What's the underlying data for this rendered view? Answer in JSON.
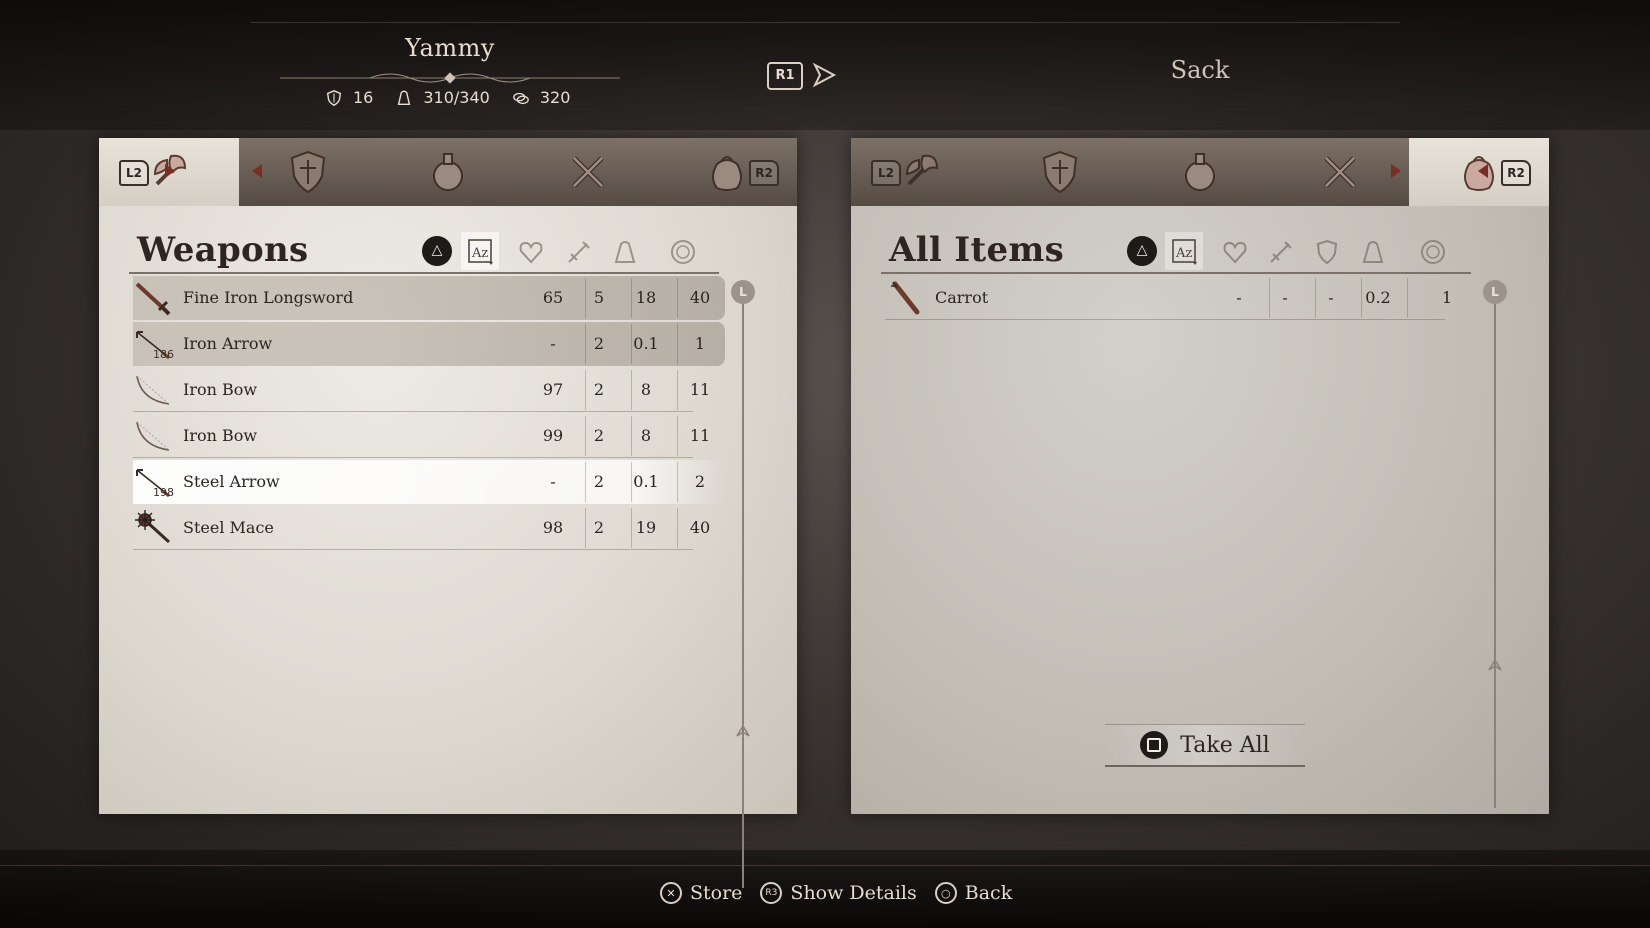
{
  "header": {
    "character_name": "Yammy",
    "defense": "16",
    "weight": "310/340",
    "money": "320",
    "r1_label": "R1",
    "container_title": "Sack"
  },
  "left_panel": {
    "bumper_left": "L2",
    "bumper_right": "R2",
    "tabs": [
      {
        "icon": "axe-icon",
        "active": true
      },
      {
        "icon": "armor-shield-icon",
        "active": false
      },
      {
        "icon": "potion-icon",
        "active": false
      },
      {
        "icon": "tools-icon",
        "active": false
      },
      {
        "icon": "food-sack-icon",
        "active": false
      }
    ],
    "title": "Weapons",
    "sort_button": "△",
    "stick_label": "L",
    "items": [
      {
        "name": "Fine Iron Longsword",
        "qty": "",
        "icon": "sword-icon",
        "c1": "65",
        "c2": "5",
        "c3": "18",
        "c4": "40"
      },
      {
        "name": "Iron Arrow",
        "qty": "186",
        "icon": "arrow-icon",
        "c1": "-",
        "c2": "2",
        "c3": "0.1",
        "c4": "1"
      },
      {
        "name": "Iron Bow",
        "qty": "",
        "icon": "bow-icon",
        "c1": "97",
        "c2": "2",
        "c3": "8",
        "c4": "11"
      },
      {
        "name": "Iron Bow",
        "qty": "",
        "icon": "bow-icon",
        "c1": "99",
        "c2": "2",
        "c3": "8",
        "c4": "11"
      },
      {
        "name": "Steel Arrow",
        "qty": "198",
        "icon": "arrow-icon",
        "c1": "-",
        "c2": "2",
        "c3": "0.1",
        "c4": "2"
      },
      {
        "name": "Steel Mace",
        "qty": "",
        "icon": "mace-icon",
        "c1": "98",
        "c2": "2",
        "c3": "19",
        "c4": "40"
      }
    ]
  },
  "right_panel": {
    "bumper_left": "L2",
    "bumper_right": "R2",
    "title": "All Items",
    "sort_button": "△",
    "stick_label": "L",
    "items": [
      {
        "name": "Carrot",
        "icon": "carrot-icon",
        "c1": "-",
        "c2": "-",
        "c3": "-",
        "c4": "0.2",
        "c5": "1"
      }
    ],
    "take_all_label": "Take All"
  },
  "footer": {
    "store_label": "Store",
    "details_label": "Show Details",
    "back_label": "Back",
    "r3_label": "R3"
  },
  "colors": {
    "parchment": "#e3dfd8",
    "ink": "#2b2420",
    "accent_red": "#7a2d22",
    "selected_row": "#ffffff"
  }
}
